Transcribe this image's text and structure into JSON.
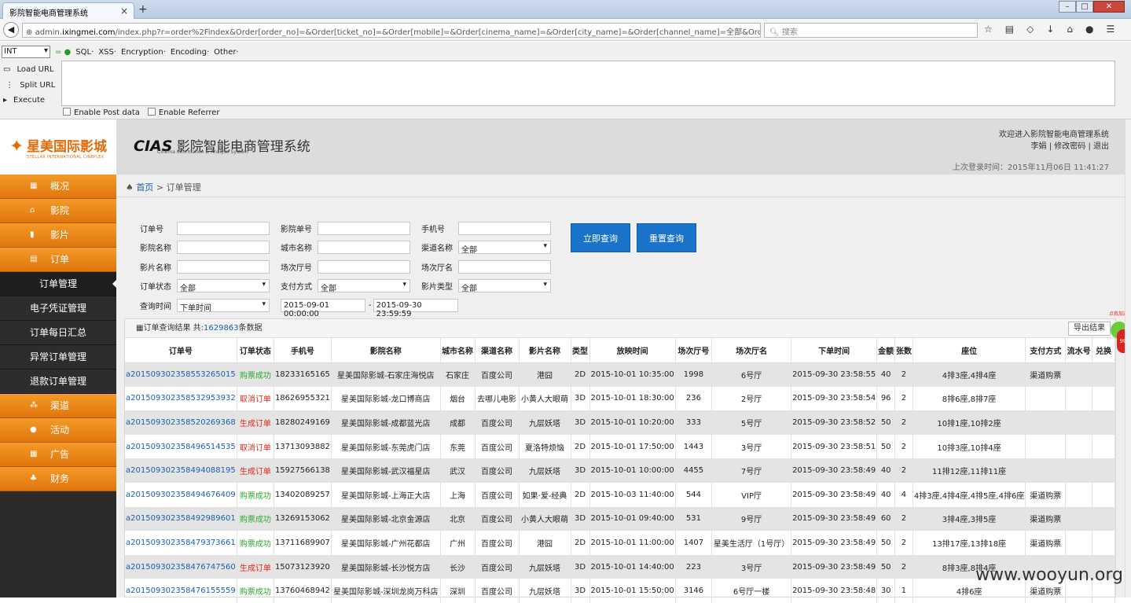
{
  "browser": {
    "tab_title": "影院智能电商管理系统",
    "url_prefix": "admin.",
    "url_domain": "ixingmei.com",
    "url_rest": "/index.php?r=order%2Findex&Order[order_no]=&Order[ticket_no]=&Order[mobile]=&Order[cinema_name]=&Order[city_name]=&Order[channel_name]=全部&Order[movie_name]=8",
    "search_placeholder": "搜索"
  },
  "hackbar": {
    "type_select": "INT",
    "menus": [
      "SQL·",
      "XSS·",
      "Encryption·",
      "Encoding·",
      "Other·"
    ],
    "actions": [
      "Load URL",
      "Split URL",
      "Execute"
    ],
    "checks": [
      "Enable Post data",
      "Enable Referrer"
    ]
  },
  "logo": {
    "cn": "星美国际影城",
    "en": "STELLAR INTERNATIONAL CINEPLEX"
  },
  "header": {
    "brand_abbr": "CIAS",
    "brand_name": "影院智能电商管理系统",
    "brand_sub": "Cinema Information & Analyse System",
    "welcome": "欢迎进入影院智能电商管理系统",
    "user_links": "李娟 | 修改密码 | 退出",
    "last_login": "上次登录时间：2015年11月06日 11:41:27"
  },
  "sidebar": {
    "main_items": [
      {
        "label": "概况",
        "icon": "▦"
      },
      {
        "label": "影院",
        "icon": "⌂"
      },
      {
        "label": "影片",
        "icon": "▮"
      },
      {
        "label": "订单",
        "icon": "▤"
      }
    ],
    "sub_items": [
      "订单管理",
      "电子凭证管理",
      "订单每日汇总",
      "异常订单管理",
      "退款订单管理"
    ],
    "bottom_items": [
      {
        "label": "渠道",
        "icon": "⁂"
      },
      {
        "label": "活动",
        "icon": "●"
      },
      {
        "label": "广告",
        "icon": "▦"
      },
      {
        "label": "财务",
        "icon": "♣"
      }
    ]
  },
  "breadcrumb": {
    "home": "首页",
    "sep": " > ",
    "current": "订单管理"
  },
  "form": {
    "order_no": "订单号",
    "ticket_no": "影院单号",
    "mobile": "手机号",
    "cinema": "影院名称",
    "city": "城市名称",
    "channel": "渠道名称",
    "channel_val": "全部",
    "movie": "影片名称",
    "hall_no": "场次厅号",
    "hall_name": "场次厅名",
    "status": "订单状态",
    "status_val": "全部",
    "pay": "支付方式",
    "pay_val": "全部",
    "mtype": "影片类型",
    "mtype_val": "全部",
    "qtime": "查询时间",
    "qtime_val": "下单时间",
    "start": "2015-09-01 00:00:00",
    "dash": "-",
    "end": "2015-09-30 23:59:59",
    "query_btn": "立即查询",
    "reset_btn": "重置查询"
  },
  "results": {
    "title_prefix": "▦订单查询结果  共:",
    "count": "1629863",
    "title_suffix": "条数据",
    "export": "导出结果",
    "columns": [
      "订单号",
      "订单状态",
      "手机号",
      "影院名称",
      "城市名称",
      "渠道名称",
      "影片名称",
      "类型",
      "放映时间",
      "场次厅号",
      "场次厅名",
      "下单时间",
      "金额",
      "张数",
      "座位",
      "支付方式",
      "流水号",
      "兑换"
    ],
    "rows": [
      [
        "a2015093023585532650l5",
        "购票成功",
        "18233165165",
        "星美国际影城-石家庄海悦店",
        "石家庄",
        "百度公司",
        "港囧",
        "2D",
        "2015-10-01 10:35:00",
        "1998",
        "6号厅",
        "2015-09-30 23:58:55",
        "40",
        "2",
        "4排3座,4排4座",
        "渠道购票",
        "",
        ""
      ],
      [
        "a2015093023585329539​32",
        "取消订单",
        "18626955321",
        "星美国际影城-龙口博商店",
        "烟台",
        "去哪儿电影",
        "小黄人大眼萌",
        "3D",
        "2015-10-01 18:30:00",
        "236",
        "2号厅",
        "2015-09-30 23:58:54",
        "96",
        "2",
        "8排6座,8排7座",
        "",
        "",
        ""
      ],
      [
        "a201509302358520269368",
        "生成订单",
        "18280249169",
        "星美国际影城-成都蓝光店",
        "成都",
        "百度公司",
        "九层妖塔",
        "3D",
        "2015-10-01 10:20:00",
        "333",
        "5号厅",
        "2015-09-30 23:58:52",
        "50",
        "2",
        "10排1座,10排2座",
        "",
        "",
        ""
      ],
      [
        "a201509302358496514535",
        "取消订单",
        "13713093882",
        "星美国际影城-东莞虎门店",
        "东莞",
        "百度公司",
        "夏洛特烦恼",
        "2D",
        "2015-10-01 17:50:00",
        "1443",
        "3号厅",
        "2015-09-30 23:58:51",
        "50",
        "2",
        "10排3座,10排4座",
        "",
        "",
        ""
      ],
      [
        "a201509302358494088195",
        "生成订单",
        "15927566138",
        "星美国际影城-武汉福星店",
        "武汉",
        "百度公司",
        "九层妖塔",
        "3D",
        "2015-10-01 10:00:00",
        "4455",
        "7号厅",
        "2015-09-30 23:58:49",
        "40",
        "2",
        "11排12座,11排11座",
        "",
        "",
        ""
      ],
      [
        "a201509302358494676409",
        "购票成功",
        "13402089257",
        "星美国际影城-上海正大店",
        "上海",
        "百度公司",
        "如果·爱-经典",
        "2D",
        "2015-10-03 11:40:00",
        "544",
        "VIP厅",
        "2015-09-30 23:58:49",
        "40",
        "4",
        "4排3座,4排4座,4排5座,4排6座",
        "渠道购票",
        "",
        ""
      ],
      [
        "a201509302358492989601",
        "购票成功",
        "13269153062",
        "星美国际影城-北京金源店",
        "北京",
        "百度公司",
        "小黄人大眼萌",
        "3D",
        "2015-10-01 09:40:00",
        "531",
        "9号厅",
        "2015-09-30 23:58:49",
        "60",
        "2",
        "3排4座,3排5座",
        "渠道购票",
        "",
        ""
      ],
      [
        "a201509302358479373661",
        "购票成功",
        "13711689907",
        "星美国际影城-广州花都店",
        "广州",
        "百度公司",
        "港囧",
        "2D",
        "2015-10-01 11:00:00",
        "1407",
        "星美生活厅（1号厅）",
        "2015-09-30 23:58:49",
        "50",
        "2",
        "13排17座,13排18座",
        "渠道购票",
        "",
        ""
      ],
      [
        "a201509302358476747560",
        "生成订单",
        "15073123920",
        "星美国际影城-长沙悦方店",
        "长沙",
        "百度公司",
        "九层妖塔",
        "3D",
        "2015-10-01 14:40:00",
        "223",
        "3号厅",
        "2015-09-30 23:58:49",
        "50",
        "2",
        "8排3座,8排4座",
        "",
        "",
        ""
      ],
      [
        "a201509302358476155559",
        "购票成功",
        "13760468942",
        "星美国际影城-深圳龙岗万科店",
        "深圳",
        "百度公司",
        "九层妖塔",
        "3D",
        "2015-10-01 15:50:00",
        "3146",
        "6号厅一楼",
        "2015-09-30 23:58:48",
        "30",
        "1",
        "4排6座",
        "渠道购票",
        "",
        ""
      ]
    ]
  },
  "overlay": {
    "float_text": "点我加速",
    "float_num": "90",
    "watermark": "www.wooyun.org"
  }
}
